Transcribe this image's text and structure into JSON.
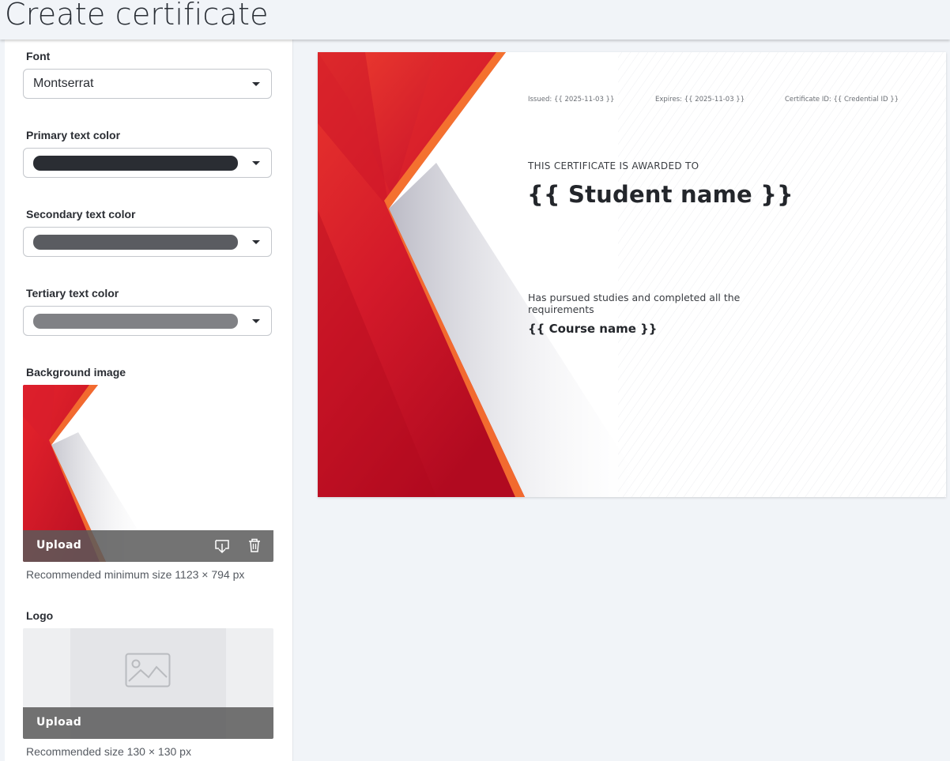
{
  "header": {
    "title": "Create certificate"
  },
  "sidebar": {
    "font": {
      "label": "Font",
      "value": "Montserrat"
    },
    "primary_color": {
      "label": "Primary text color",
      "color": "#2a2d33"
    },
    "secondary_color": {
      "label": "Secondary text color",
      "color": "#5a5c61"
    },
    "tertiary_color": {
      "label": "Tertiary text color",
      "color": "#808185"
    },
    "background_image": {
      "label": "Background image",
      "upload_label": "Upload",
      "hint": "Recommended minimum size 1123 × 794 px",
      "icons": [
        "download-icon",
        "trash-icon"
      ]
    },
    "logo": {
      "label": "Logo",
      "upload_label": "Upload",
      "hint": "Recommended size 130 × 130 px",
      "icon": "image-placeholder-icon"
    }
  },
  "certificate": {
    "issued": "Issued: {{ 2025-11-03 }}",
    "expires": "Expires: {{ 2025-11-03 }}",
    "credential": "Certificate ID: {{ Credential ID }}",
    "awarded_to": "THIS CERTIFICATE IS AWARDED TO",
    "student_name": "{{ Student name }}",
    "pursued_text": "Has pursued studies and completed all the requirements",
    "course_name": "{{ Course name }}"
  },
  "colors": {
    "accent_red": "#d4172a",
    "accent_orange": "#f26a2f"
  }
}
